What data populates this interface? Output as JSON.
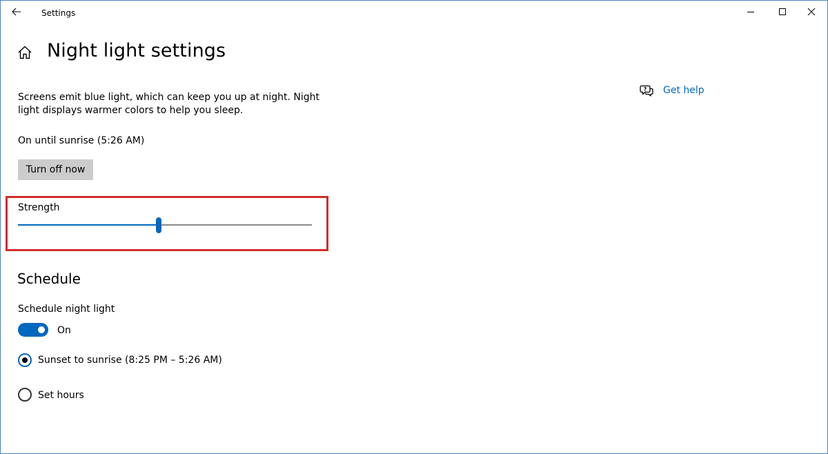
{
  "window": {
    "title": "Settings"
  },
  "titlebar": {
    "back_icon": "back-arrow-icon",
    "minimize_icon": "minimize-icon",
    "maximize_icon": "maximize-icon",
    "close_icon": "close-icon"
  },
  "header": {
    "home_icon": "home-icon",
    "title": "Night light settings"
  },
  "night_light": {
    "description": "Screens emit blue light, which can keep you up at night. Night light displays warmer colors to help you sleep.",
    "status": "On until sunrise (5:26 AM)",
    "turn_off_label": "Turn off now"
  },
  "strength": {
    "label": "Strength",
    "value_fraction": 0.48
  },
  "schedule": {
    "section_title": "Schedule",
    "toggle_label": "Schedule night light",
    "toggle_state": "On",
    "options": [
      {
        "label": "Sunset to sunrise (8:25 PM – 5:26 AM)",
        "selected": true
      },
      {
        "label": "Set hours",
        "selected": false
      }
    ]
  },
  "help": {
    "icon": "help-chat-icon",
    "label": "Get help"
  },
  "colors": {
    "accent": "#0067c0",
    "highlight_border": "#d12d2d",
    "button_bg": "#cccccc"
  }
}
